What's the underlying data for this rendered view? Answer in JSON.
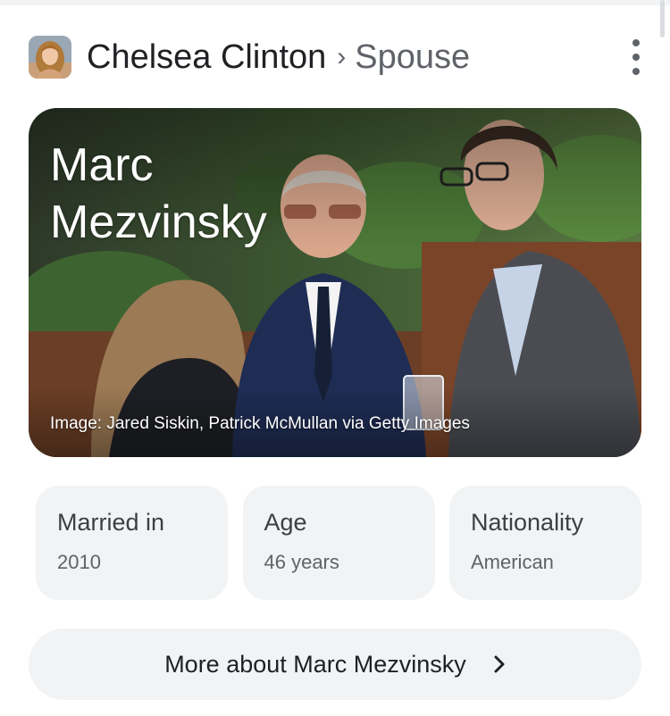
{
  "header": {
    "title": "Chelsea Clinton",
    "separator": "›",
    "subtitle": "Spouse",
    "avatar_icon": "person-photo-icon",
    "menu_icon": "more-vert-icon"
  },
  "hero": {
    "name": "Marc Mezvinsky",
    "credit": "Image: Jared Siskin, Patrick McMullan via Getty Images"
  },
  "facts": [
    {
      "label": "Married in",
      "value": "2010"
    },
    {
      "label": "Age",
      "value": "46 years"
    },
    {
      "label": "Nationality",
      "value": "American"
    }
  ],
  "more_button": {
    "label": "More about Marc Mezvinsky",
    "icon": "chevron-right-icon"
  },
  "colors": {
    "chip_background": "#f1f3f4",
    "text_primary": "#202124",
    "text_secondary": "#5f6368"
  }
}
